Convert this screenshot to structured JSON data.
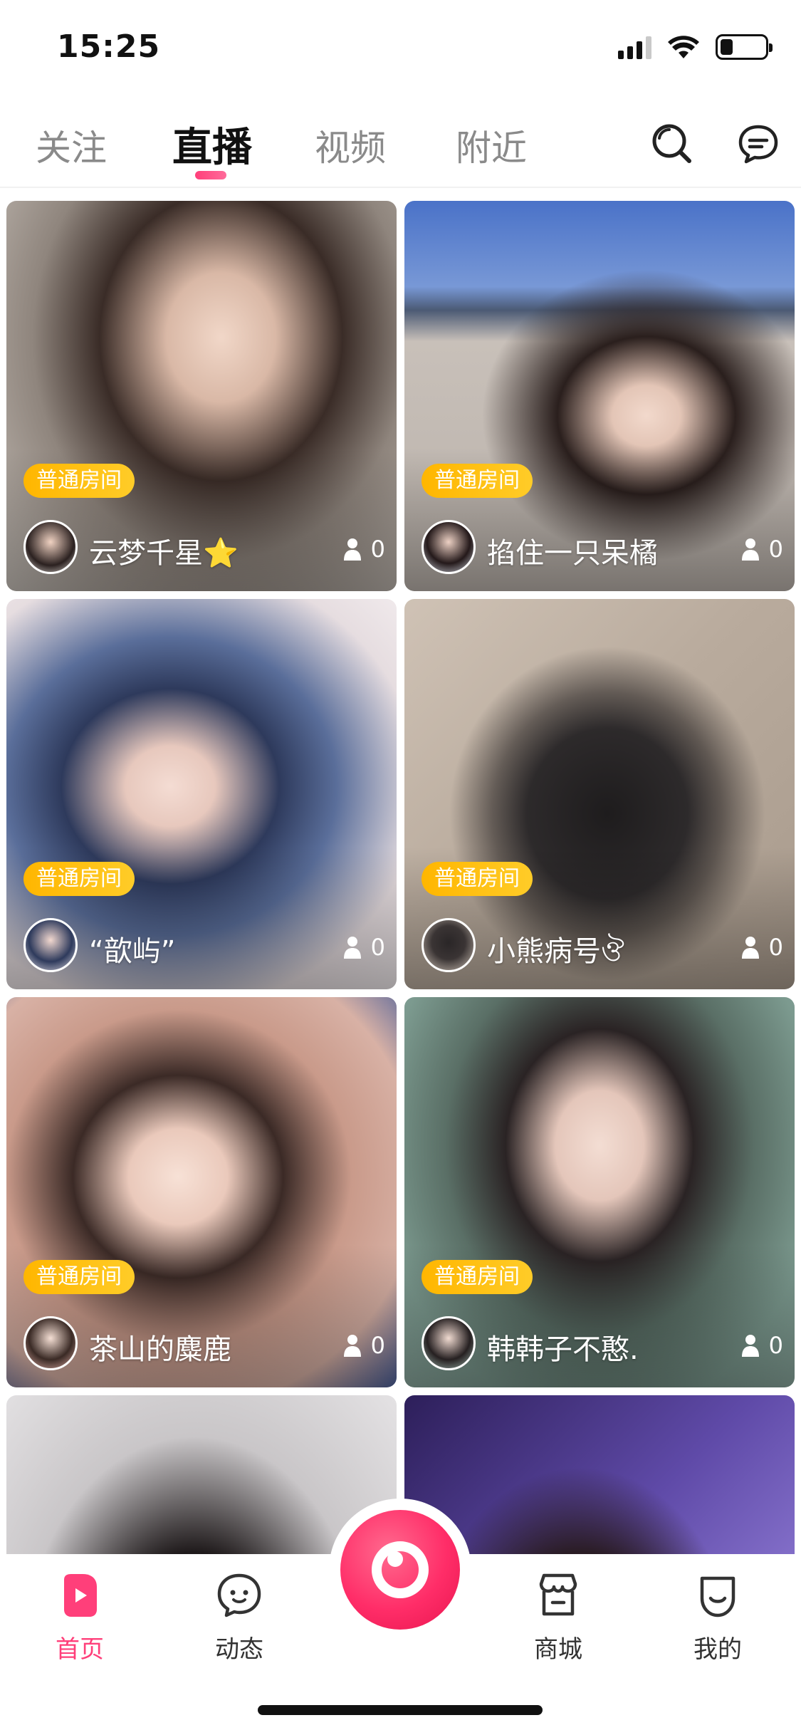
{
  "status_bar": {
    "time": "15:25"
  },
  "top_tabs": [
    {
      "label": "关注",
      "active": false
    },
    {
      "label": "直播",
      "active": true
    },
    {
      "label": "视频",
      "active": false
    },
    {
      "label": "附近",
      "active": false
    }
  ],
  "top_icons": [
    "search-icon",
    "message-icon"
  ],
  "feed": [
    {
      "badge": "普通房间",
      "name": "云梦千星⭐",
      "viewers": "0"
    },
    {
      "badge": "普通房间",
      "name": "掐住一只呆橘",
      "viewers": "0"
    },
    {
      "badge": "普通房间",
      "name": "“歆屿”",
      "viewers": "0"
    },
    {
      "badge": "普通房间",
      "name": "小熊病号ঔ",
      "viewers": "0"
    },
    {
      "badge": "普通房间",
      "name": "茶山的麋鹿",
      "viewers": "0"
    },
    {
      "badge": "普通房间",
      "name": "韩韩子不憨.",
      "viewers": "0"
    },
    {
      "badge": "",
      "name": "",
      "viewers": ""
    },
    {
      "badge": "",
      "name": "",
      "viewers": ""
    }
  ],
  "bottom_nav": [
    {
      "label": "首页",
      "icon": "home-icon",
      "active": true
    },
    {
      "label": "动态",
      "icon": "chat-bubble-icon",
      "active": false
    },
    {
      "label": "商城",
      "icon": "shop-icon",
      "active": false
    },
    {
      "label": "我的",
      "icon": "profile-icon",
      "active": false
    }
  ],
  "colors": {
    "accent": "#ff3f7a",
    "badge": "#ffbf14",
    "text_dark": "#111111",
    "text_muted": "#8a8a8a"
  }
}
